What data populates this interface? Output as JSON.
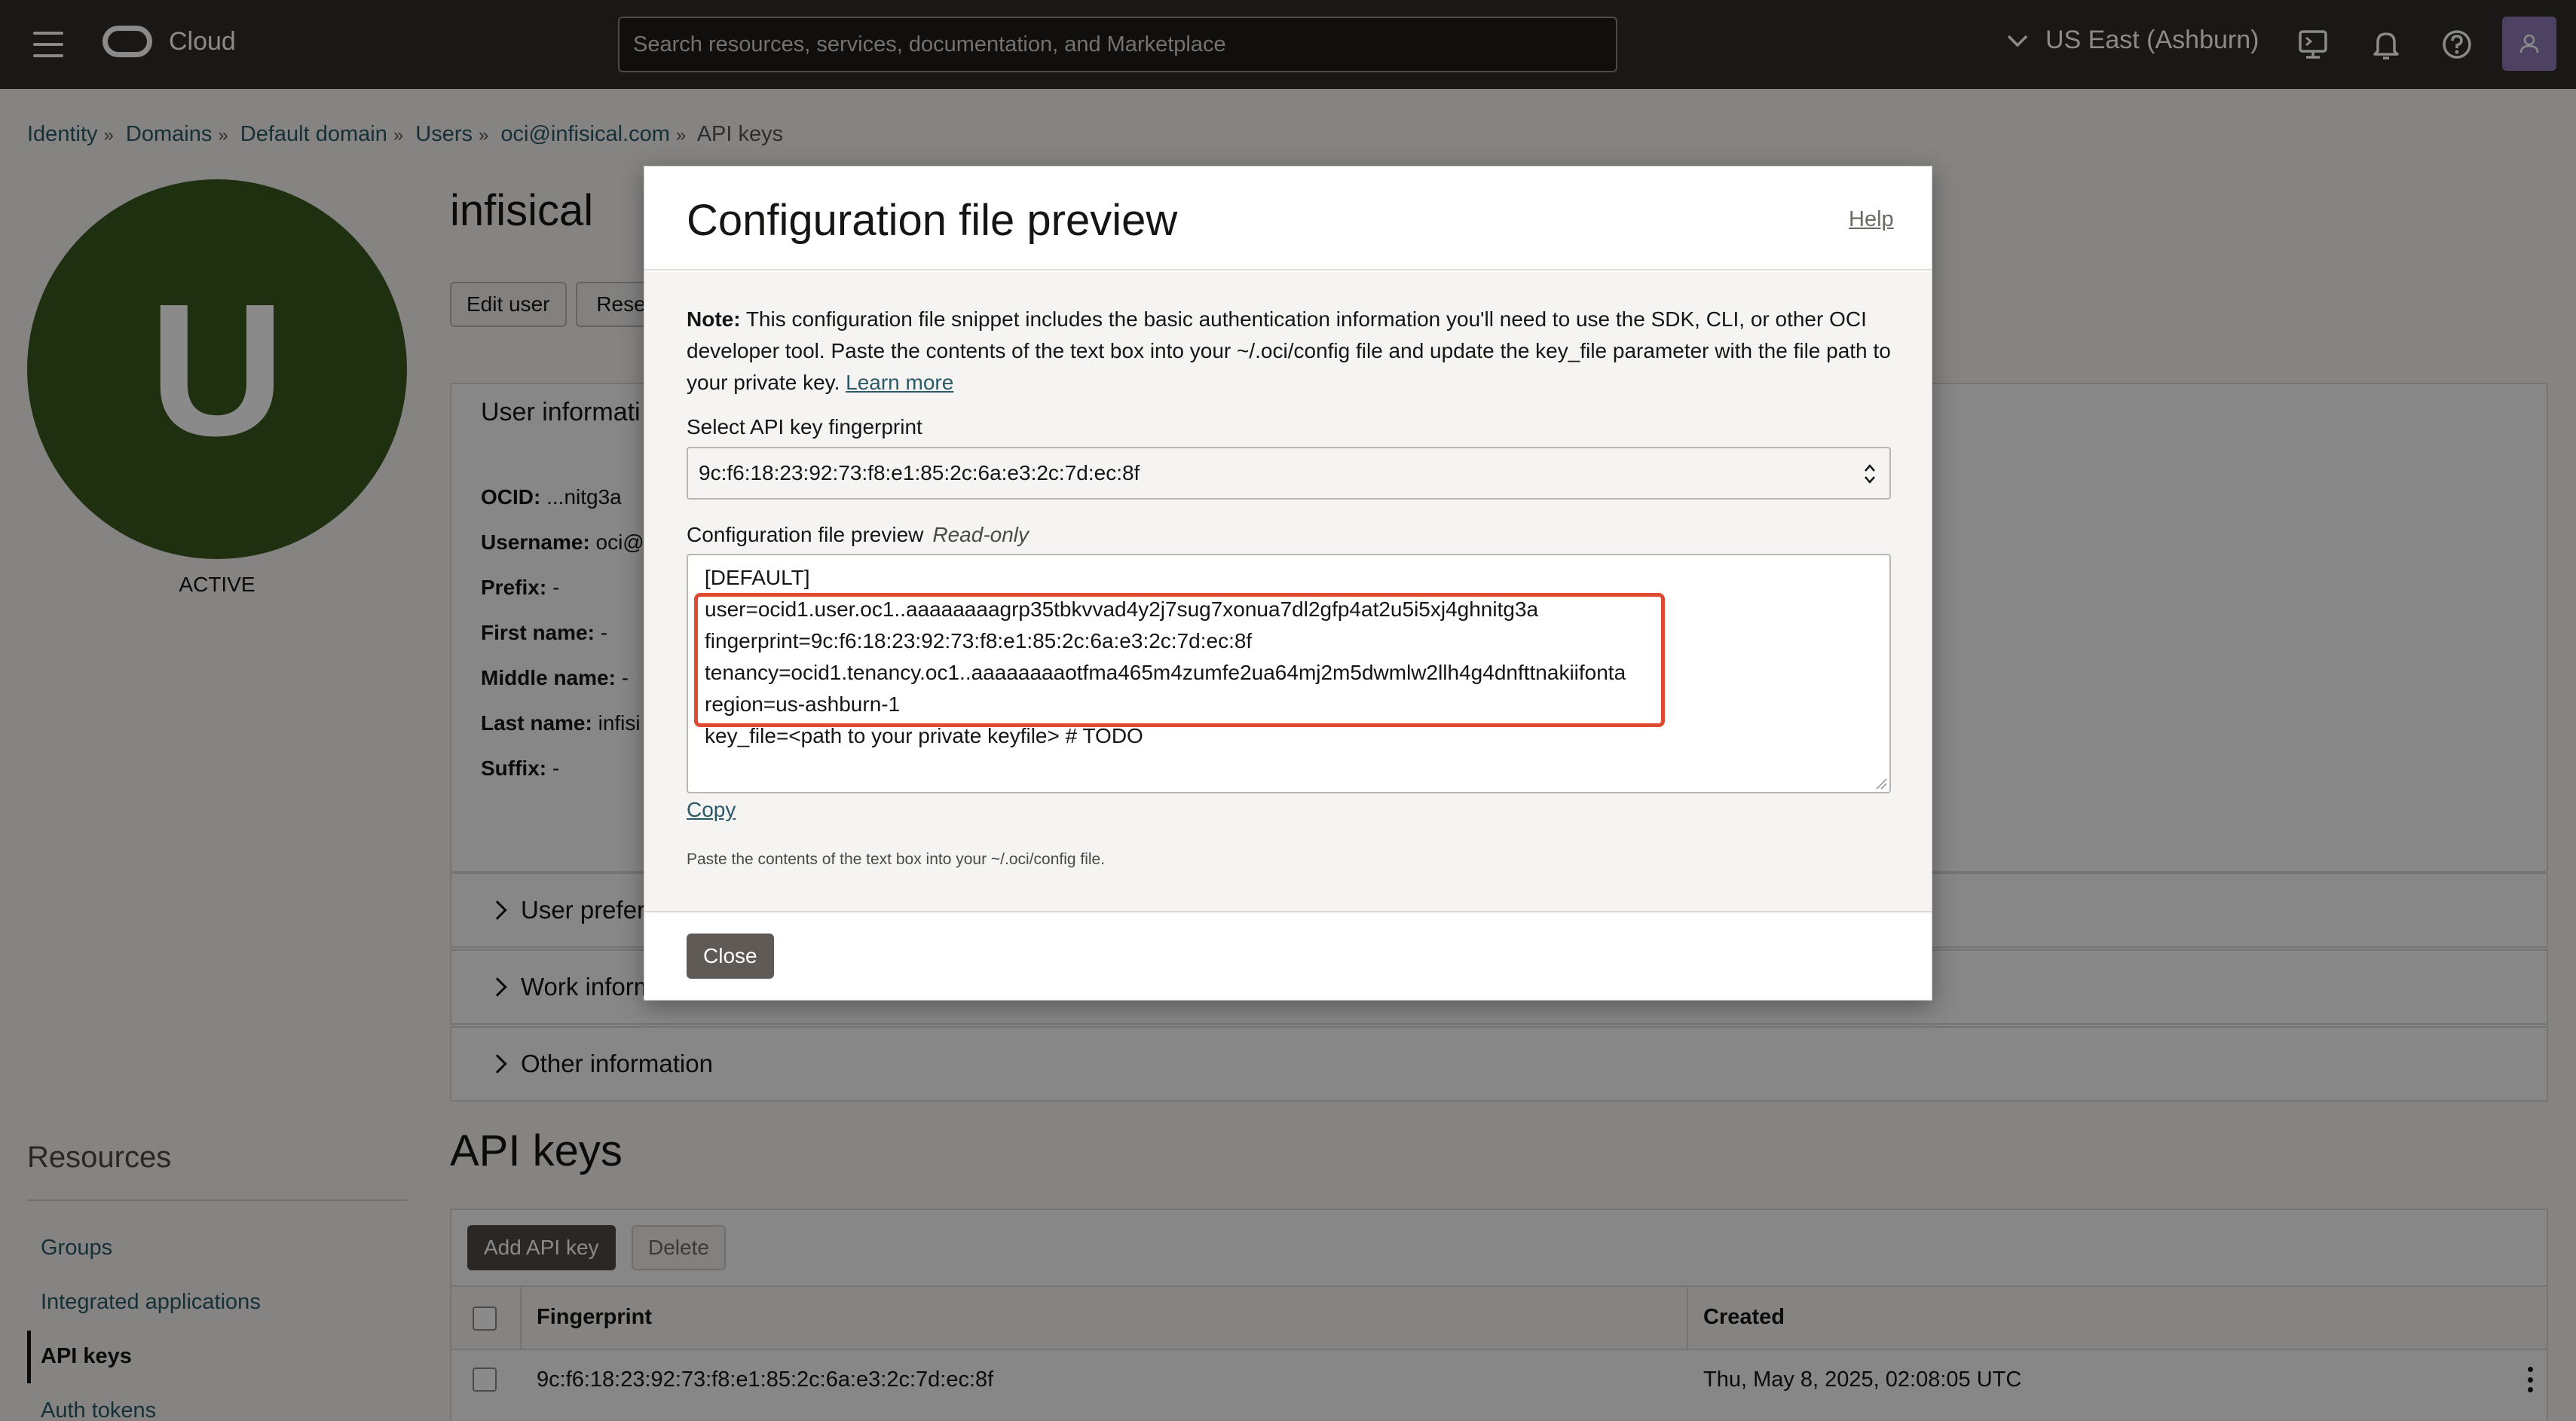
{
  "header": {
    "brand": "Cloud",
    "search_placeholder": "Search resources, services, documentation, and Marketplace",
    "region": "US East (Ashburn)"
  },
  "breadcrumb": [
    "Identity",
    "Domains",
    "Default domain",
    "Users",
    "oci@infisical.com",
    "API keys"
  ],
  "user": {
    "avatar_letter": "U",
    "status": "ACTIVE",
    "name": "infisical",
    "name_visible": "infisical",
    "buttons": {
      "edit": "Edit user",
      "reset": "Rese"
    }
  },
  "user_info": {
    "heading": "User informati",
    "rows": [
      {
        "label": "OCID:",
        "value": "...nitg3a"
      },
      {
        "label": "Username:",
        "value": "oci@"
      },
      {
        "label": "Prefix:",
        "value": "-"
      },
      {
        "label": "First name:",
        "value": "-"
      },
      {
        "label": "Middle name:",
        "value": "-"
      },
      {
        "label": "Last name:",
        "value": "infisi"
      },
      {
        "label": "Suffix:",
        "value": "-"
      }
    ]
  },
  "accordions": [
    "User prefer",
    "Work inform",
    "Other information"
  ],
  "resources": {
    "title": "Resources",
    "items": [
      "Groups",
      "Integrated applications",
      "API keys",
      "Auth tokens"
    ],
    "active_index": 2
  },
  "api_keys": {
    "title": "API keys",
    "add_button": "Add API key",
    "delete_button": "Delete",
    "columns": [
      "Fingerprint",
      "Created"
    ],
    "rows": [
      {
        "fingerprint": "9c:f6:18:23:92:73:f8:e1:85:2c:6a:e3:2c:7d:ec:8f",
        "created": "Thu, May 8, 2025, 02:08:05 UTC"
      }
    ]
  },
  "dialog": {
    "title": "Configuration file preview",
    "help": "Help",
    "note_bold": "Note:",
    "note_text": " This configuration file snippet includes the basic authentication information you'll need to use the SDK, CLI, or other OCI developer tool. Paste the contents of the text box into your ~/.oci/config file and update the key_file parameter with the file path to your private key. ",
    "learn_more": "Learn more",
    "select_label": "Select API key fingerprint",
    "select_value": "9c:f6:18:23:92:73:f8:e1:85:2c:6a:e3:2c:7d:ec:8f",
    "preview_label": "Configuration file preview",
    "preview_readonly": "Read-only",
    "config_lines": [
      "[DEFAULT]",
      "user=ocid1.user.oc1..aaaaaaaagrp35tbkvvad4y2j7sug7xonua7dl2gfp4at2u5i5xj4ghnitg3a",
      "fingerprint=9c:f6:18:23:92:73:f8:e1:85:2c:6a:e3:2c:7d:ec:8f",
      "tenancy=ocid1.tenancy.oc1..aaaaaaaaotfma465m4zumfe2ua64mj2m5dwmlw2llh4g4dnfttnakiifonta",
      "region=us-ashburn-1",
      "key_file=<path to your private keyfile> # TODO"
    ],
    "copy": "Copy",
    "hint": "Paste the contents of the text box into your ~/.oci/config file.",
    "close": "Close"
  },
  "colors": {
    "header_bg": "#312d2a",
    "avatar_bg": "#3a5a1e",
    "link": "#2c5967",
    "highlight": "#e04a30"
  }
}
